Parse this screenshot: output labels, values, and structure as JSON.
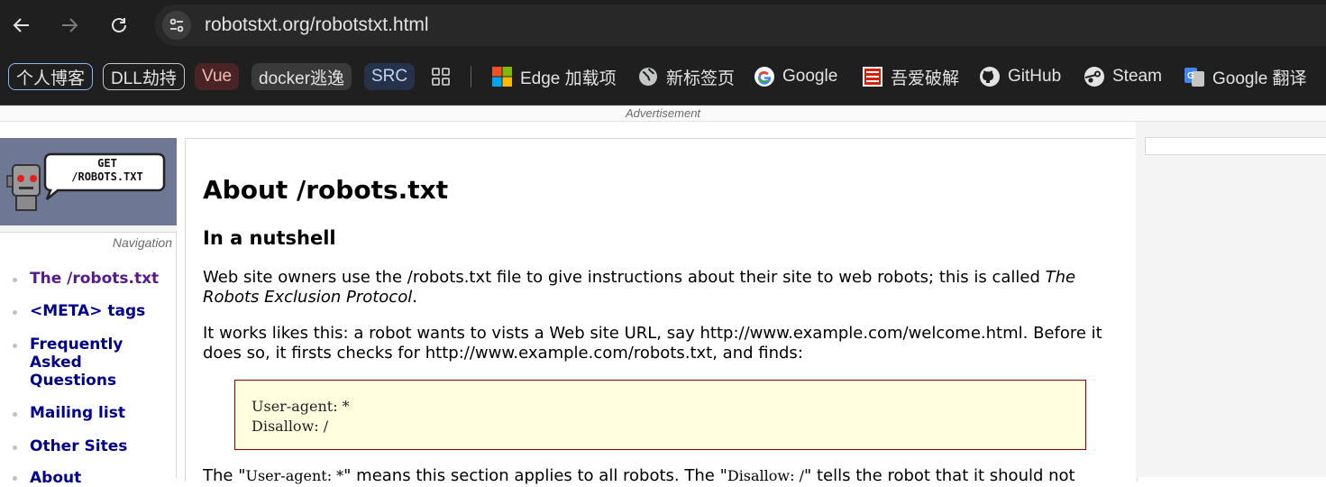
{
  "browser": {
    "url": "robotstxt.org/robotstxt.html",
    "bookmarks": [
      {
        "label": "个人博客"
      },
      {
        "label": "DLL劫持"
      },
      {
        "label": "Vue"
      },
      {
        "label": "docker逃逸"
      },
      {
        "label": "SRC"
      },
      {
        "label": "Edge 加载项"
      },
      {
        "label": "新标签页"
      },
      {
        "label": "Google"
      },
      {
        "label": "吾爱破解"
      },
      {
        "label": "GitHub"
      },
      {
        "label": "Steam"
      },
      {
        "label": "Google 翻译"
      }
    ]
  },
  "page": {
    "ad_label": "Advertisement",
    "logo_text_line1": "GET",
    "logo_text_line2": "/ROBOTS.TXT",
    "nav_caption": "Navigation",
    "nav_items": [
      {
        "label": "The /robots.txt"
      },
      {
        "label": "<META> tags"
      },
      {
        "label": "Frequently Asked Questions"
      },
      {
        "label": "Mailing list"
      },
      {
        "label": "Other Sites"
      },
      {
        "label": "About"
      }
    ],
    "title": "About /robots.txt",
    "subtitle": "In a nutshell",
    "para1_a": "Web site owners use the /robots.txt file to give instructions about their site to web robots; this is called ",
    "para1_em": "The Robots Exclusion Protocol",
    "para1_b": ".",
    "para2": "It works likes this: a robot wants to vists a Web site URL, say http://www.example.com/welcome.html. Before it does so, it firsts checks for http://www.example.com/robots.txt, and finds:",
    "code": "User-agent: *\nDisallow: /",
    "para3_a": "The \"",
    "para3_code1": "User-agent: *",
    "para3_b": "\" means this section applies to all robots. The \"",
    "para3_code2": "Disallow: /",
    "para3_c": "\" tells the robot that it should not"
  }
}
